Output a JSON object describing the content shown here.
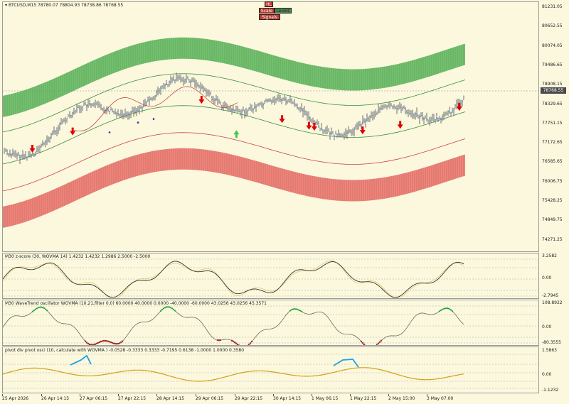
{
  "window": {
    "symbol_info": "BTCUSD,M15  78780.07 78804.93 78738.86 78768.55",
    "current_price": "78768.55"
  },
  "buttons": [
    {
      "label": "HL",
      "color": "#c0392b"
    },
    {
      "label": "Scale",
      "color": "#c0392b"
    },
    {
      "label": "Levels",
      "color": "#4f8a55"
    },
    {
      "label": "Signals",
      "color": "#c0392b"
    }
  ],
  "main_axis": {
    "labels": [
      "81231.05",
      "80652.55",
      "80074.05",
      "79486.65",
      "78908.15",
      "78329.65",
      "77751.15",
      "77172.65",
      "76585.65",
      "76006.75",
      "75428.25",
      "74849.75",
      "74271.25"
    ]
  },
  "panels": {
    "zscore": {
      "title": "M30 z-score (30, WOVMA 14) 1.4232 1.4232 1.2986 2.5000 -2.5000",
      "axis": [
        "3.2582",
        "0.00",
        "-2.7945"
      ]
    },
    "wavetrend": {
      "title": "M30 WaveTrend oscillator WOVMA (10,21,filter 0,0) 60.0000 40.0000 0.0000 -40.0000 -60.0000 43.0256 43.0256 45.3571",
      "axis": [
        "108.8922",
        "0.00",
        "-80.3555"
      ]
    },
    "pivot": {
      "title": "pivot div pivot osci (10, calculate with WOVMA ) -0.0528 -0.3333 0.3333 -0.7195 0.6138 -1.0000 1.0000 0.3580",
      "axis": [
        "1.5863",
        "0.00",
        "-1.1232"
      ]
    }
  },
  "x_axis": {
    "labels": [
      "25 Apr 2026",
      "26 Apr 14:15",
      "27 Apr 06:15",
      "27 Apr 22:15",
      "28 Apr 14:15",
      "29 Apr 06:15",
      "29 Apr 22:15",
      "30 Apr 14:15",
      "1 May 06:15",
      "1 May 22:15",
      "2 May 15:00",
      "3 May 07:00"
    ]
  },
  "colors": {
    "background": "#fbf8dd",
    "upper_band": "#5cb85c",
    "lower_band": "#f0706a",
    "candle": "#6b6b6b",
    "sell_arrow": "#e00000",
    "buy_arrow": "#4cc34c",
    "wt_up": "#33dd55",
    "wt_down": "#cc1111",
    "pivot_line": "#d4a017",
    "pivot_hi": "#1ea0e6"
  },
  "signals": {
    "sell": [
      0.055,
      0.13,
      0.37,
      0.57,
      0.52,
      0.58,
      0.67,
      0.74,
      0.85
    ],
    "buy": [
      0.435
    ]
  }
}
